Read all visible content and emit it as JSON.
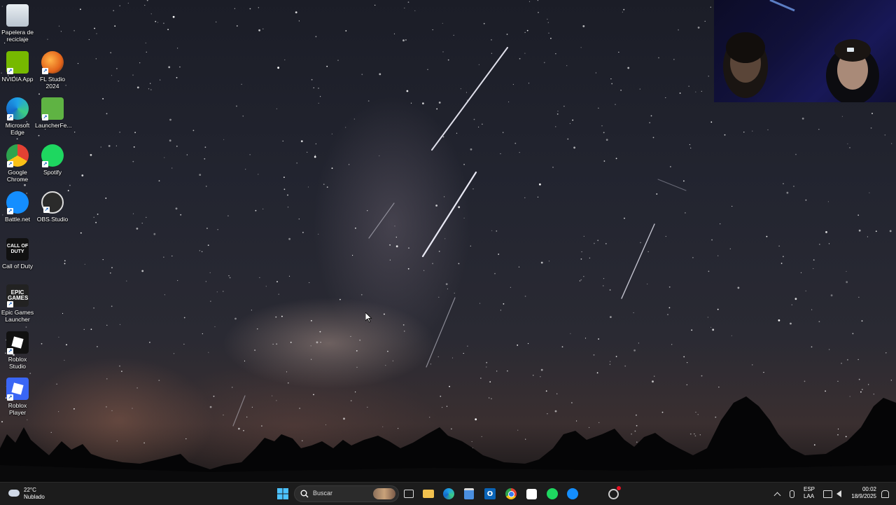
{
  "desktop": {
    "icons": [
      {
        "label": "Papelera de reciclaje",
        "icon": "recycle-bin-icon"
      },
      {
        "label": "NVIDIA App",
        "icon": "nvidia-icon"
      },
      {
        "label": "FL Studio 2024",
        "icon": "fl-studio-icon"
      },
      {
        "label": "Microsoft Edge",
        "icon": "edge-icon"
      },
      {
        "label": "LauncherFe...",
        "icon": "creeper-icon"
      },
      {
        "label": "Google Chrome",
        "icon": "chrome-icon"
      },
      {
        "label": "Spotify",
        "icon": "spotify-icon"
      },
      {
        "label": "Battle.net",
        "icon": "battlenet-icon"
      },
      {
        "label": "OBS Studio",
        "icon": "obs-icon"
      },
      {
        "label": "Call of Duty",
        "icon": "call-of-duty-icon"
      },
      {
        "label": "Epic Games Launcher",
        "icon": "epic-games-icon"
      },
      {
        "label": "Roblox Studio",
        "icon": "roblox-studio-icon"
      },
      {
        "label": "Roblox Player",
        "icon": "roblox-player-icon"
      }
    ],
    "icon_text": {
      "cod": "CALL OF DUTY",
      "epic_1": "EPIC",
      "epic_2": "GAMES"
    }
  },
  "taskbar": {
    "weather": {
      "temp": "22°C",
      "condition": "Nublado"
    },
    "search_placeholder": "Buscar",
    "tray": {
      "lang_1": "ESP",
      "lang_2": "LAA",
      "time": "00:02",
      "date": "18/9/2025"
    }
  },
  "colors": {
    "taskbar": "#1c1c1c",
    "accent": "#0078d4"
  }
}
